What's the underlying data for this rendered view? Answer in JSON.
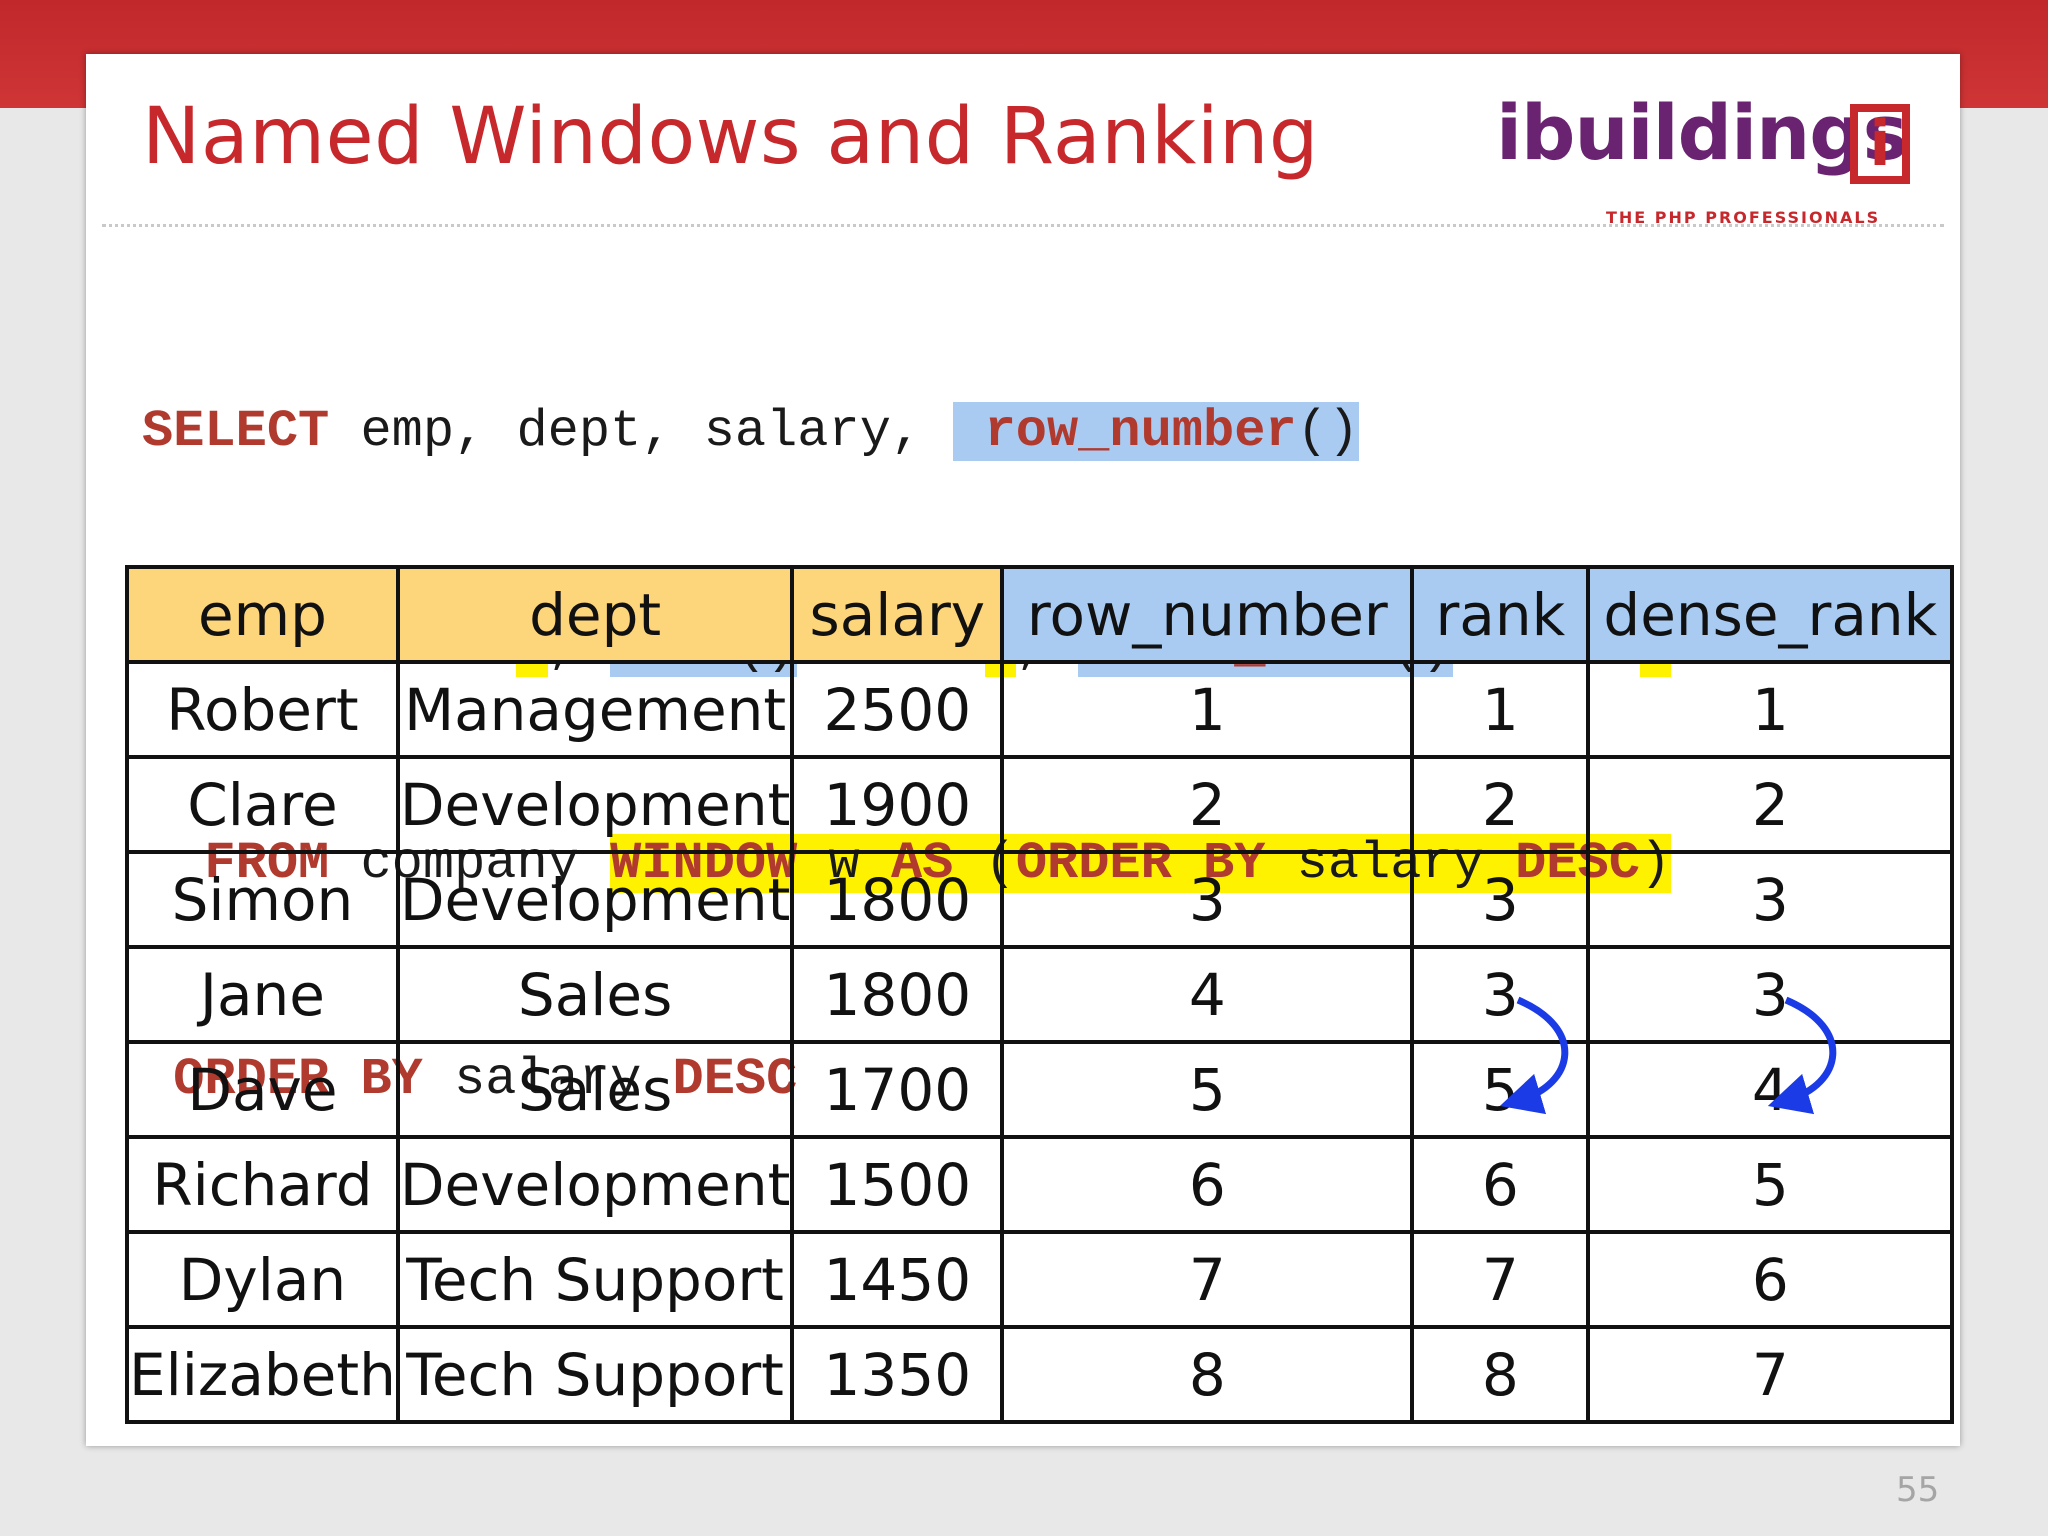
{
  "title": "Named Windows and Ranking",
  "logo": {
    "word": "ibuildings",
    "bracket_letter": "i",
    "tagline": "THE PHP PROFESSIONALS"
  },
  "sql": {
    "l1": {
      "kw_select": "SELECT",
      "cols": " emp, dept, salary, ",
      "fn_row_number": "row_number",
      "paren1": "()"
    },
    "l2": {
      "kw_over1": "OVER",
      "w1": "w",
      "comma1": ", ",
      "fn_rank": "rank",
      "paren2": "()",
      "kw_over2": "OVER",
      "w2": "w",
      "comma2": ", ",
      "fn_dense": "dense_rank",
      "paren3": "()",
      "kw_over3": "OVER",
      "w3": "w"
    },
    "l3": {
      "kw_from": "FROM",
      "table": " company ",
      "kw_window": "WINDOW",
      "wname": " w ",
      "kw_as": "AS",
      "open": " (",
      "kw_orderby": "ORDER BY",
      "col": " salary ",
      "kw_desc": "DESC",
      "close": ")"
    },
    "l4": {
      "kw_orderby": "ORDER BY",
      "col": " salary ",
      "kw_desc": "DESC"
    }
  },
  "table": {
    "headers": [
      "emp",
      "dept",
      "salary",
      "row_number",
      "rank",
      "dense_rank"
    ],
    "rows": [
      [
        "Robert",
        "Management",
        "2500",
        "1",
        "1",
        "1"
      ],
      [
        "Clare",
        "Development",
        "1900",
        "2",
        "2",
        "2"
      ],
      [
        "Simon",
        "Development",
        "1800",
        "3",
        "3",
        "3"
      ],
      [
        "Jane",
        "Sales",
        "1800",
        "4",
        "3",
        "3"
      ],
      [
        "Dave",
        "Sales",
        "1700",
        "5",
        "5",
        "4"
      ],
      [
        "Richard",
        "Development",
        "1500",
        "6",
        "6",
        "5"
      ],
      [
        "Dylan",
        "Tech Support",
        "1450",
        "7",
        "7",
        "6"
      ],
      [
        "Elizabeth",
        "Tech Support",
        "1350",
        "8",
        "8",
        "7"
      ]
    ]
  },
  "colors": {
    "title_red": "#c7282c",
    "keyword_red": "#b03a2e",
    "highlight_blue": "#a9cbf2",
    "highlight_yellow": "#fff200",
    "header_orange": "#fdd57a",
    "arrow_blue": "#1a3be6",
    "logo_purple": "#6a2370"
  },
  "page_number": "55"
}
